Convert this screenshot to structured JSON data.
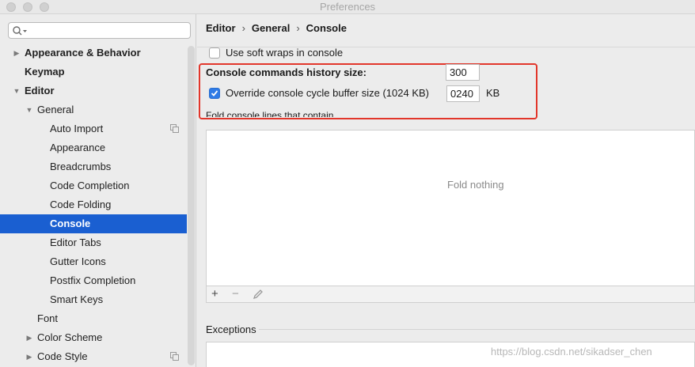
{
  "window": {
    "title": "Preferences"
  },
  "search": {
    "placeholder": ""
  },
  "sidebar": {
    "items": [
      {
        "label": "Appearance & Behavior",
        "bold": true,
        "arrow": "▶",
        "indent": 0
      },
      {
        "label": "Keymap",
        "bold": true,
        "arrow": "",
        "indent": 0
      },
      {
        "label": "Editor",
        "bold": true,
        "arrow": "▼",
        "indent": 0
      },
      {
        "label": "General",
        "bold": false,
        "arrow": "▼",
        "indent": 1
      },
      {
        "label": "Auto Import",
        "bold": false,
        "arrow": "",
        "indent": 2,
        "copy_icon": true
      },
      {
        "label": "Appearance",
        "bold": false,
        "arrow": "",
        "indent": 2
      },
      {
        "label": "Breadcrumbs",
        "bold": false,
        "arrow": "",
        "indent": 2
      },
      {
        "label": "Code Completion",
        "bold": false,
        "arrow": "",
        "indent": 2
      },
      {
        "label": "Code Folding",
        "bold": false,
        "arrow": "",
        "indent": 2
      },
      {
        "label": "Console",
        "bold": false,
        "arrow": "",
        "indent": 2,
        "selected": true
      },
      {
        "label": "Editor Tabs",
        "bold": false,
        "arrow": "",
        "indent": 2
      },
      {
        "label": "Gutter Icons",
        "bold": false,
        "arrow": "",
        "indent": 2
      },
      {
        "label": "Postfix Completion",
        "bold": false,
        "arrow": "",
        "indent": 2
      },
      {
        "label": "Smart Keys",
        "bold": false,
        "arrow": "",
        "indent": 2
      },
      {
        "label": "Font",
        "bold": false,
        "arrow": "",
        "indent": 1
      },
      {
        "label": "Color Scheme",
        "bold": false,
        "arrow": "▶",
        "indent": 1
      },
      {
        "label": "Code Style",
        "bold": false,
        "arrow": "▶",
        "indent": 1,
        "copy_icon": true
      }
    ]
  },
  "breadcrumb": {
    "items": [
      "Editor",
      "General",
      "Console"
    ],
    "separator": "›"
  },
  "settings": {
    "soft_wraps_label": "Use soft wraps in console",
    "soft_wraps_checked": false,
    "history_label": "Console commands history size:",
    "history_value": "300",
    "override_label": "Override console cycle buffer size (1024 KB)",
    "override_checked": true,
    "override_value": "0240",
    "override_unit": "KB",
    "fold_label": "Fold console lines that contain",
    "fold_empty": "Fold nothing",
    "exceptions_label": "Exceptions"
  },
  "toolbar": {
    "add": "+",
    "remove": "−",
    "edit_icon": "pencil-icon"
  },
  "watermark": "https://blog.csdn.net/sikadser_chen",
  "colors": {
    "selection": "#1a5fd1",
    "highlight_box": "#e2362b",
    "checkbox_on": "#2f7be6"
  }
}
